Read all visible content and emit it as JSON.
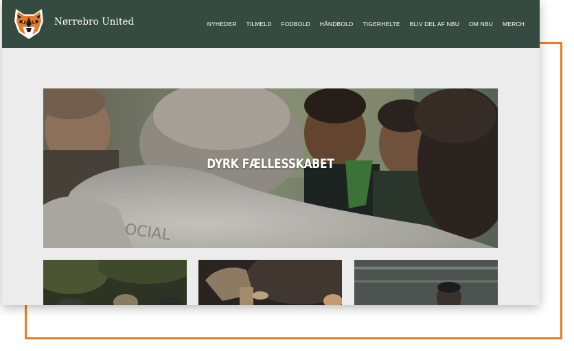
{
  "colors": {
    "header_bg": "#354a41",
    "page_bg": "#ebeceb",
    "accent_frame": "#ef7b1f",
    "text_light": "#ffffff"
  },
  "header": {
    "logo_icon": "tiger-head-icon",
    "brand": "Nørrebro United",
    "nav": [
      "NYHEDER",
      "TILMELD",
      "FODBOLD",
      "HÅNDBOLD",
      "TIGERHELTE",
      "BLIV DEL AF NBU",
      "OM NBU",
      "MERCH"
    ]
  },
  "hero": {
    "title": "DYRK FÆLLESSKABET"
  },
  "cards": [
    {
      "image": "players-in-park-photo"
    },
    {
      "image": "kettle-pouring-photo"
    },
    {
      "image": "player-portrait-photo"
    }
  ]
}
